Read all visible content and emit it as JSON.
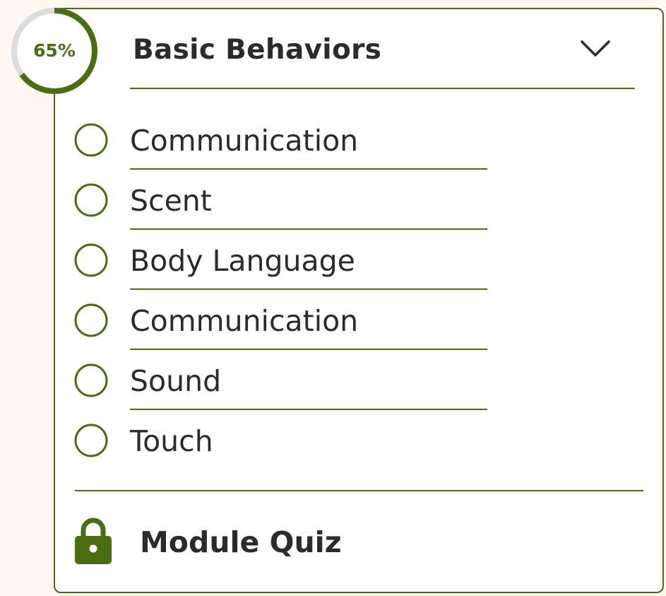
{
  "module": {
    "title": "Basic Behaviors",
    "progress_label": "65%",
    "progress_fraction": 0.65,
    "expanded": true,
    "toggle_icon": "chevron-down-icon"
  },
  "lessons": [
    {
      "label": "Communication",
      "status_icon": "empty-circle-icon"
    },
    {
      "label": "Scent",
      "status_icon": "empty-circle-icon"
    },
    {
      "label": "Body Language",
      "status_icon": "empty-circle-icon"
    },
    {
      "label": "Communication",
      "status_icon": "empty-circle-icon"
    },
    {
      "label": "Sound",
      "status_icon": "empty-circle-icon"
    },
    {
      "label": "Touch",
      "status_icon": "empty-circle-icon"
    }
  ],
  "quiz": {
    "label": "Module Quiz",
    "icon": "lock-icon",
    "locked": true
  },
  "colors": {
    "accent": "#4a6d12",
    "track": "#dcdcdc",
    "text": "#2b2b2b",
    "page_bg": "#fff8f2"
  }
}
